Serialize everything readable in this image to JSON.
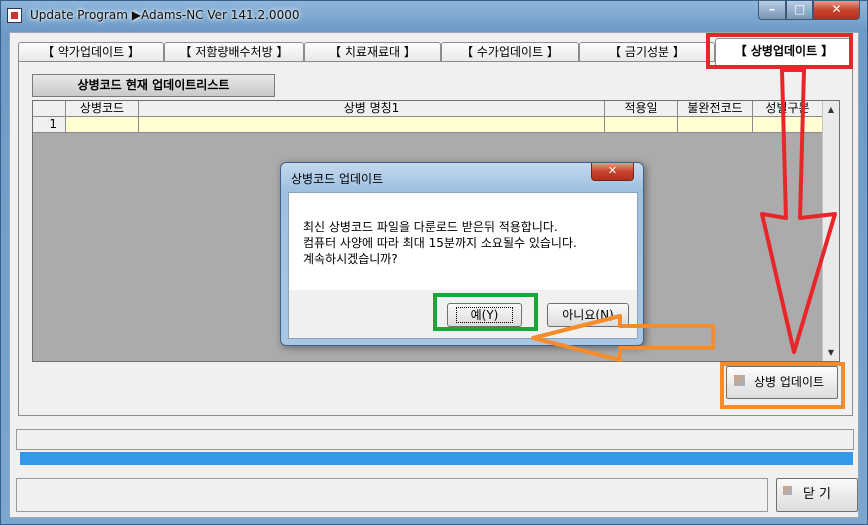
{
  "window": {
    "title": "Update Program  ▶Adams-NC Ver 141.2.0000",
    "controls": {
      "minimize": "–",
      "maximize": "□",
      "close": "✕"
    }
  },
  "tabs": [
    {
      "label": "【 약가업데이트 】",
      "active": false
    },
    {
      "label": "【 저함량배수처방 】",
      "active": false
    },
    {
      "label": "【 치료재료대 】",
      "active": false
    },
    {
      "label": "【 수가업데이트 】",
      "active": false
    },
    {
      "label": "【 금기성분 】",
      "active": false
    },
    {
      "label": "【 상병업데이트 】",
      "active": true
    }
  ],
  "panel": {
    "section_title": "상병코드 현재 업데이트리스트",
    "grid": {
      "columns": [
        "상병코드",
        "상병 명칭1",
        "적용일",
        "불완전코드",
        "성별구분"
      ],
      "rows": [
        {
          "num": "1",
          "cells": [
            "",
            "",
            "",
            "",
            ""
          ]
        }
      ]
    },
    "update_button": "상병 업데이트"
  },
  "progress": {
    "fraction": 1.0,
    "color": "#3398ea"
  },
  "close_button": "닫  기",
  "dialog": {
    "title": "상병코드 업데이트",
    "close_glyph": "✕",
    "lines": [
      "최신 상병코드 파일을 다룬로드 받은뒤 적용합니다.",
      "컴퓨터 사양에 따라 최대 15분까지 소요될수 있습니다.",
      "계속하시겠습니까?"
    ],
    "yes_button": "예(Y)",
    "no_button": "아니요(N)"
  },
  "annotations": {
    "red": "#e8262a",
    "orange": "#f58b2a",
    "green": "#17a63a"
  }
}
